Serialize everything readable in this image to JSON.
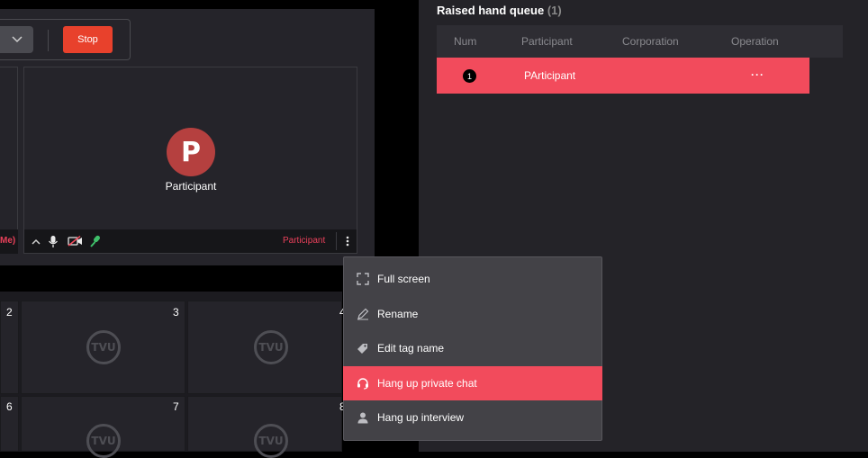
{
  "toolbar": {
    "stop_label": "Stop"
  },
  "video": {
    "left_tile_label": "Me)",
    "main_tile": {
      "avatar_letter": "P",
      "name": "Participant",
      "role": "Participant"
    }
  },
  "grid": {
    "numbers": [
      "2",
      "3",
      "4",
      "6",
      "7",
      "8"
    ],
    "watermark": "TVU"
  },
  "raised_hand": {
    "title": "Raised hand queue",
    "count": "(1)",
    "columns": [
      "Num",
      "Participant",
      "Corporation",
      "Operation"
    ],
    "rows": [
      {
        "num": "1",
        "participant": "PArticipant",
        "corporation": "",
        "operation": "···"
      }
    ]
  },
  "context_menu": {
    "items": [
      {
        "label": "Full screen",
        "icon": "fullscreen-icon"
      },
      {
        "label": "Rename",
        "icon": "pencil-icon"
      },
      {
        "label": "Edit tag name",
        "icon": "tag-icon"
      },
      {
        "label": "Hang up private chat",
        "icon": "headset-icon",
        "active": true
      },
      {
        "label": "Hang up interview",
        "icon": "person-icon"
      }
    ]
  },
  "colors": {
    "accent": "#f24b5c",
    "stop": "#e8412c",
    "avatar": "#b5403f",
    "panel": "#242328"
  }
}
